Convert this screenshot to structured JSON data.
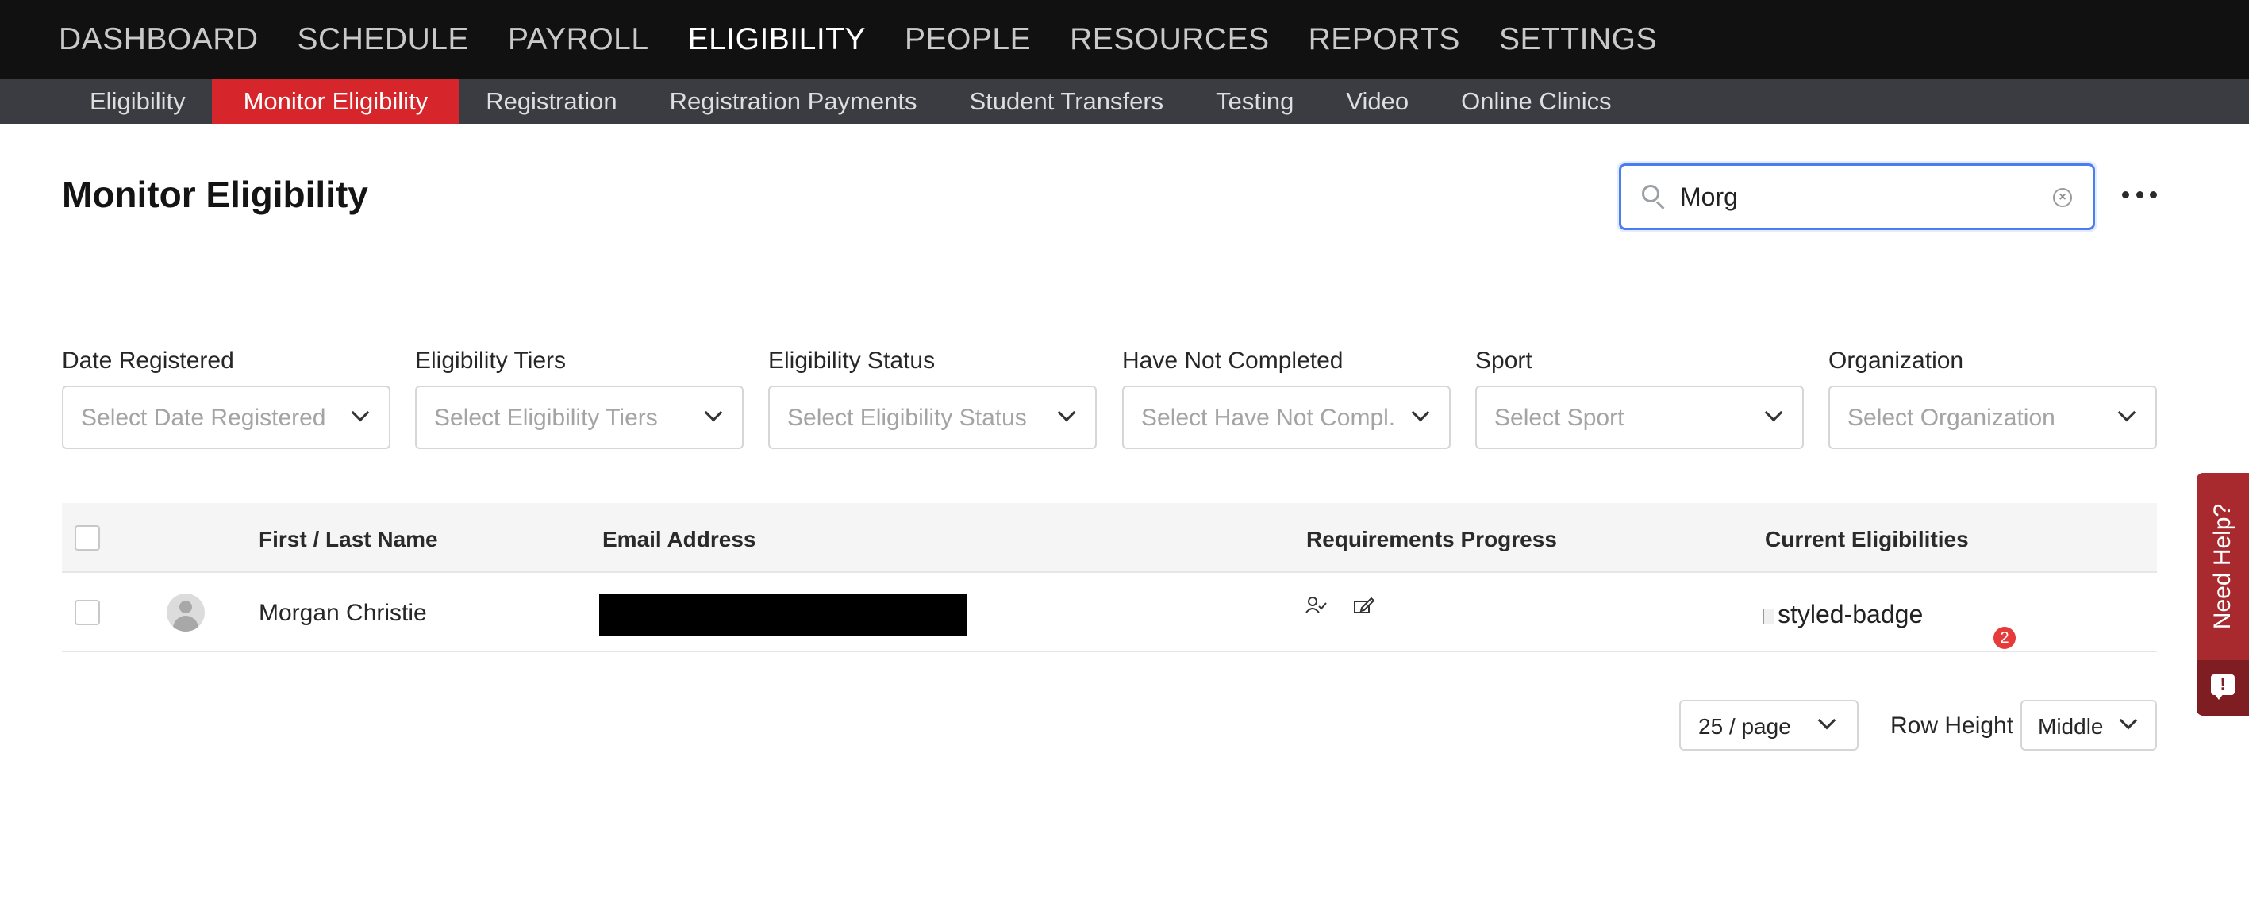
{
  "top_nav": {
    "items": [
      {
        "label": "DASHBOARD",
        "active": false
      },
      {
        "label": "SCHEDULE",
        "active": false
      },
      {
        "label": "PAYROLL",
        "active": false
      },
      {
        "label": "ELIGIBILITY",
        "active": true
      },
      {
        "label": "PEOPLE",
        "active": false
      },
      {
        "label": "RESOURCES",
        "active": false
      },
      {
        "label": "REPORTS",
        "active": false
      },
      {
        "label": "SETTINGS",
        "active": false
      }
    ]
  },
  "sub_nav": {
    "items": [
      {
        "label": "Eligibility",
        "active": false
      },
      {
        "label": "Monitor Eligibility",
        "active": true
      },
      {
        "label": "Registration",
        "active": false
      },
      {
        "label": "Registration Payments",
        "active": false
      },
      {
        "label": "Student Transfers",
        "active": false
      },
      {
        "label": "Testing",
        "active": false
      },
      {
        "label": "Video",
        "active": false
      },
      {
        "label": "Online Clinics",
        "active": false
      }
    ]
  },
  "page": {
    "title": "Monitor Eligibility"
  },
  "search": {
    "value": "Morg",
    "icon": "search-icon",
    "clear_icon": "clear-icon"
  },
  "filters": [
    {
      "label": "Date Registered",
      "placeholder": "Select Date Registered"
    },
    {
      "label": "Eligibility Tiers",
      "placeholder": "Select Eligibility Tiers"
    },
    {
      "label": "Eligibility Status",
      "placeholder": "Select Eligibility Status"
    },
    {
      "label": "Have Not Completed",
      "placeholder": "Select Have Not Compl..."
    },
    {
      "label": "Sport",
      "placeholder": "Select Sport"
    },
    {
      "label": "Organization",
      "placeholder": "Select Organization"
    }
  ],
  "table": {
    "headers": {
      "name": "First / Last Name",
      "email": "Email Address",
      "requirements": "Requirements Progress",
      "eligibilities": "Current Eligibilities"
    },
    "rows": [
      {
        "name": "Morgan Christie",
        "email_redacted": true,
        "requirement_icons": [
          "user-check-icon",
          "edit-form-icon"
        ],
        "eligibility_badge_alt": "styled-badge",
        "eligibility_count": "2"
      }
    ]
  },
  "pagination": {
    "page_size": "25 / page"
  },
  "row_height": {
    "label": "Row Height",
    "value": "Middle"
  },
  "help": {
    "label": "Need Help?"
  },
  "colors": {
    "top_nav_bg": "#111111",
    "sub_nav_bg": "#3a3c42",
    "accent_red": "#d7262b",
    "search_focus": "#4a7ef0",
    "help_tab": "#a82a2f"
  }
}
